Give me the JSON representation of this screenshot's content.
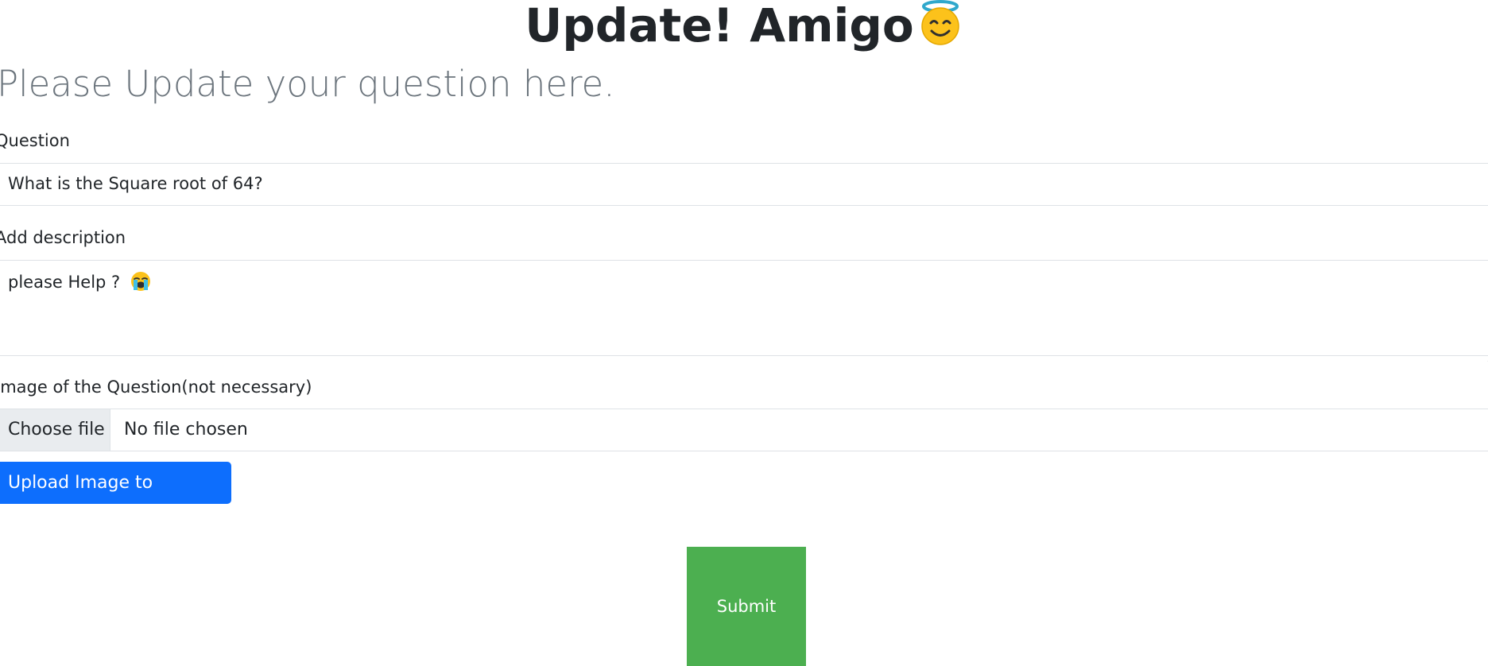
{
  "header": {
    "title": "Update! Amigo",
    "title_emoji": "smiling-face-with-halo-icon"
  },
  "subtitle": "Please Update your question here.",
  "form": {
    "question_label": "Question",
    "question_value": "What is the Square root of 64?",
    "description_label": "Add description",
    "description_value": "please Help ?",
    "description_emoji": "loudly-crying-face-icon",
    "image_label": "Image of the Question(not necessary)",
    "file_button_label": "Choose file",
    "file_status": "No file chosen",
    "upload_button_label": "Upload Image to database",
    "submit_label": "Submit"
  },
  "colors": {
    "primary": "#0d6efd",
    "submit": "#4caf50",
    "muted": "#6c757d",
    "border": "#dee2e6",
    "emoji_yellow": "#fcc21b",
    "emoji_halo": "#2fa8cc"
  }
}
